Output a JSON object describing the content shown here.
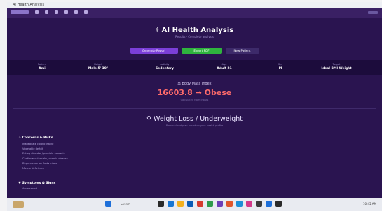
{
  "window": {
    "title": "AI Health Analysis"
  },
  "tabbar": {
    "icons": [
      "back-icon",
      "forward-icon",
      "refresh-icon",
      "home-icon",
      "star-icon",
      "tab-icon",
      "menu-icon"
    ]
  },
  "header": {
    "title": "AI Health Analysis",
    "subtitle": "Results · Complete analysis"
  },
  "actions": {
    "primary": "Generate Report",
    "secondary": "Export PDF",
    "tertiary": "New Patient"
  },
  "stats": [
    {
      "label": "Patient",
      "value": "Ami"
    },
    {
      "label": "Height",
      "value": "Male 5' 10\""
    },
    {
      "label": "Activity",
      "value": "Sedentary"
    },
    {
      "label": "Age",
      "value": "Adult 21"
    },
    {
      "label": "Sex",
      "value": "M"
    },
    {
      "label": "Target",
      "value": "Ideal BMI Weight"
    }
  ],
  "bmi": {
    "label": "Body Mass Index",
    "value": "16603.8 → Obese",
    "note": "Calculated from inputs"
  },
  "goal": {
    "title": "Weight Loss / Underweight",
    "subtitle": "Personalized plan based on your health profile"
  },
  "sections": {
    "concerns_title": "Concerns & Risks",
    "concerns": [
      "Inadequate caloric intake",
      "Vegetable deficit",
      "Eating disorder / possible anorexia",
      "Cardiovascular risks, chronic disease",
      "Dependence on fluids intake",
      "Muscle deficiency"
    ],
    "next_title": "Symptoms & Signs",
    "next_first": "Assessment"
  },
  "taskbar": {
    "search": "Search",
    "clock": "10:45 AM"
  },
  "colors": {
    "background": "#2a1450",
    "accent": "#7b3fd8",
    "success": "#2fb33e",
    "bmi": "#ff6b6b"
  }
}
